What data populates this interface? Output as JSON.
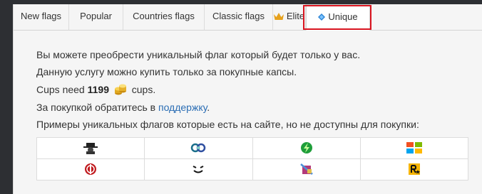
{
  "tabs": [
    {
      "label": "New flags"
    },
    {
      "label": "Popular"
    },
    {
      "label": "Countries flags"
    },
    {
      "label": "Classic flags"
    },
    {
      "label": "Elite",
      "icon": "crown-icon"
    },
    {
      "label": "Unique",
      "icon": "diamond-icon",
      "active": true
    }
  ],
  "content": {
    "line1": "Вы можете преобрести уникальный флаг который будет только у вас.",
    "line2": "Данную услугу можно купить только за покупные капсы.",
    "cups_prefix": "Cups need",
    "cups_amount": "1199",
    "cups_suffix": "cups.",
    "line4_prefix": "За покупкой обратитесь в",
    "support_link": "поддержку",
    "line4_suffix": ".",
    "line5": "Примеры уникальных флагов которые есть на сайте, но не доступны для покупки:"
  },
  "flags": [
    [
      "spy-hat-icon",
      "chain-rings-icon",
      "green-lightning-icon",
      "windows-logo-icon"
    ],
    [
      "jedi-order-icon",
      "evil-smile-icon",
      "dagger-shield-icon",
      "rockstar-logo-icon"
    ]
  ],
  "colors": {
    "highlight": "#d9141f",
    "link": "#2a6db4",
    "background": "#2d2f33"
  }
}
